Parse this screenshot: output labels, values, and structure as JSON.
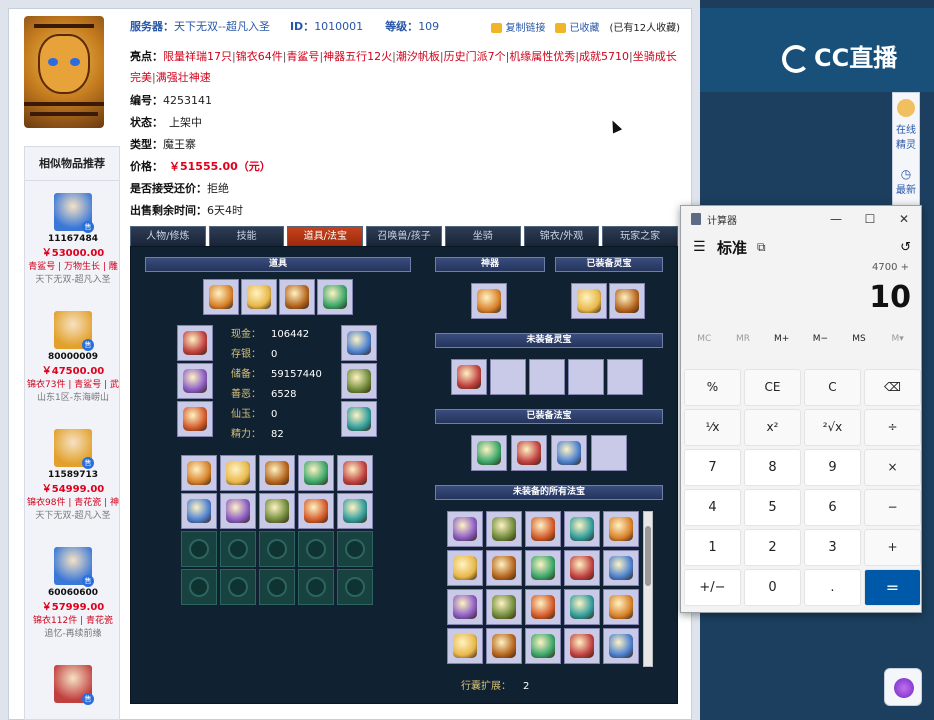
{
  "header": {
    "server_label": "服务器：",
    "server_value": "天下无双--超凡入圣",
    "id_label": "ID：",
    "id_value": "1010001",
    "level_label": "等级：",
    "level_value": "109",
    "copy_link": "复制链接",
    "favorited": "已收藏",
    "fav_count": "(已有12人收藏)"
  },
  "details": {
    "highlights_label": "亮点：",
    "highlights": [
      "限量祥瑞17只",
      "锦衣64件",
      "青鲨号",
      "神器五行12火",
      "潮汐帆板",
      "历史门派7个",
      "机缘属性优秀",
      "成就5710",
      "坐骑成长完美",
      "满强壮神速"
    ],
    "serial_label": "编号：",
    "serial_value": "4253141",
    "status_label": "状态：",
    "status_value": "上架中",
    "type_label": "类型：",
    "type_value": "魔王寨",
    "price_label": "价格：",
    "price_value": "￥51555.00（元）",
    "bargain_label": "是否接受还价：",
    "bargain_value": "拒绝",
    "remaining_label": "出售剩余时间：",
    "remaining_value": "6天4时"
  },
  "sidebar": {
    "title": "相似物品推荐",
    "items": [
      {
        "id": "11167484",
        "price": "￥53000.00",
        "tags": "青鲨号 | 万物生长 | 雕",
        "server": "天下无双-超凡入圣",
        "color": "#3a78d8"
      },
      {
        "id": "80000009",
        "price": "￥47500.00",
        "tags": "锦衣73件 | 青鲨号 | 武",
        "server": "山东1区-东海崂山",
        "color": "#e2a12c"
      },
      {
        "id": "11589713",
        "price": "￥54999.00",
        "tags": "锦衣98件 | 青花瓷 | 神",
        "server": "天下无双-超凡入圣",
        "color": "#e2a12c"
      },
      {
        "id": "60060600",
        "price": "￥57999.00",
        "tags": "锦衣112件 | 青花瓷",
        "server": "追忆-再续前缘",
        "color": "#3a78d8"
      },
      {
        "id": "",
        "price": "",
        "tags": "",
        "server": "",
        "color": "#c04040"
      }
    ]
  },
  "tabs": [
    "人物/修炼",
    "技能",
    "道具/法宝",
    "召唤兽/孩子",
    "坐骑",
    "锦衣/外观",
    "玩家之家"
  ],
  "active_tab": 2,
  "inventory": {
    "section_items": "道具",
    "section_artifact": "神器",
    "section_equipped_spirit": "已装备灵宝",
    "section_unequipped_spirit": "未装备灵宝",
    "section_equipped_treasure": "已装备法宝",
    "section_all_unequipped_treasure": "未装备的所有法宝",
    "stats": [
      {
        "k": "现金：",
        "v": "106442"
      },
      {
        "k": "存银：",
        "v": "0"
      },
      {
        "k": "储备：",
        "v": "59157440"
      },
      {
        "k": "善恶：",
        "v": "6528"
      },
      {
        "k": "仙玉：",
        "v": "0"
      },
      {
        "k": "精力：",
        "v": "82"
      }
    ],
    "expand_label": "行囊扩展：",
    "expand_value": "2"
  },
  "calculator": {
    "window_title": "计算器",
    "mode": "标准",
    "expression": "4700 +",
    "display": "10",
    "memory": [
      "MC",
      "MR",
      "M+",
      "M−",
      "MS",
      "M▾"
    ],
    "keys": [
      "%",
      "CE",
      "C",
      "⌫",
      "¹⁄x",
      "x²",
      "²√x",
      "÷",
      "7",
      "8",
      "9",
      "×",
      "4",
      "5",
      "6",
      "−",
      "1",
      "2",
      "3",
      "+",
      "+/−",
      "0",
      ".",
      "="
    ]
  },
  "right_panel": {
    "logo": "CC直播",
    "spirit_label_1": "在线",
    "spirit_label_2": "精灵",
    "clock_label": "最新"
  }
}
